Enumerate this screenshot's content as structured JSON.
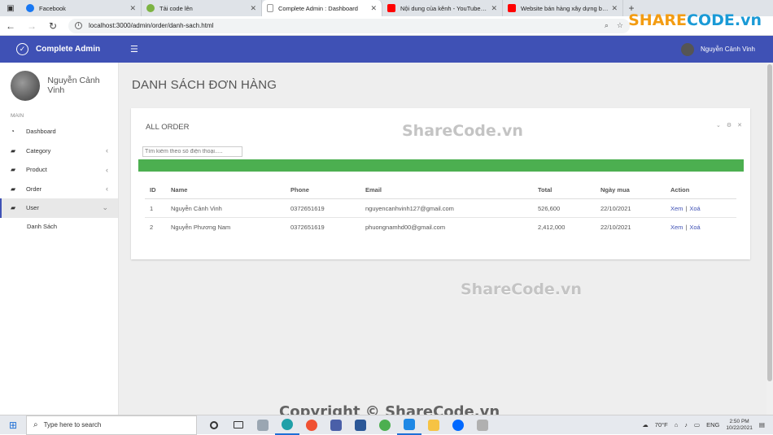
{
  "browser": {
    "tabs": [
      {
        "title": "Facebook",
        "color": "#1877f2",
        "active": false
      },
      {
        "title": "Tải code lên",
        "color": "#7cb342",
        "active": false
      },
      {
        "title": "Complete Admin : Dashboard",
        "color": "#9e9e9e",
        "active": true
      },
      {
        "title": "Nội dung của kênh - YouTube Stu",
        "color": "#ff0000",
        "active": false
      },
      {
        "title": "Website bán hàng xây dựng bằn",
        "color": "#ff0000",
        "active": false
      }
    ],
    "new_tab": "+",
    "url": "localhost:3000/admin/order/danh-sach.html"
  },
  "logo": {
    "share": "SHARE",
    "code": "CODE.vn"
  },
  "topnav": {
    "brand": "Complete Admin",
    "user_name": "Nguyễn Cảnh Vinh"
  },
  "sidebar": {
    "user_name": "Nguyễn Cảnh Vinh",
    "section": "MAIN",
    "items": [
      {
        "label": "Dashboard",
        "icon": "dashboard-icon",
        "caret": ""
      },
      {
        "label": "Category",
        "icon": "briefcase-icon",
        "caret": "‹"
      },
      {
        "label": "Product",
        "icon": "briefcase-icon",
        "caret": "‹"
      },
      {
        "label": "Order",
        "icon": "briefcase-icon",
        "caret": "‹"
      },
      {
        "label": "User",
        "icon": "briefcase-icon",
        "caret": "⌄"
      }
    ],
    "subitem": "Danh Sách"
  },
  "page": {
    "title": "DANH SÁCH ĐƠN HÀNG"
  },
  "card": {
    "title": "ALL ORDER",
    "search_placeholder": "Tìm kiếm theo số điện thoại.....",
    "bar_color": "#4caf50",
    "columns": [
      "ID",
      "Name",
      "Phone",
      "Email",
      "Total",
      "Ngày mua",
      "Action"
    ],
    "rows": [
      {
        "id": "1",
        "name": "Nguyễn Cảnh Vinh",
        "phone": "0372651619",
        "email": "nguyencanhvinh127@gmail.com",
        "total": "526,600",
        "date": "22/10/2021",
        "view": "Xem",
        "delete": "Xoá"
      },
      {
        "id": "2",
        "name": "Nguyễn Phương Nam",
        "phone": "0372651619",
        "email": "phuongnamhd00@gmail.com",
        "total": "2,412,000",
        "date": "22/10/2021",
        "view": "Xem",
        "delete": "Xoá"
      }
    ],
    "action_sep": "|"
  },
  "watermarks": {
    "wm1": "ShareCode.vn",
    "wm2": "ShareCode.vn",
    "copyright": "Copyright © ShareCode.vn"
  },
  "taskbar": {
    "search": "Type here to search",
    "weather": "70°F",
    "lang": "ENG",
    "time": "2:50 PM",
    "date": "10/22/2021"
  },
  "colors": {
    "primary": "#3f51b5",
    "accent_green": "#4caf50"
  }
}
